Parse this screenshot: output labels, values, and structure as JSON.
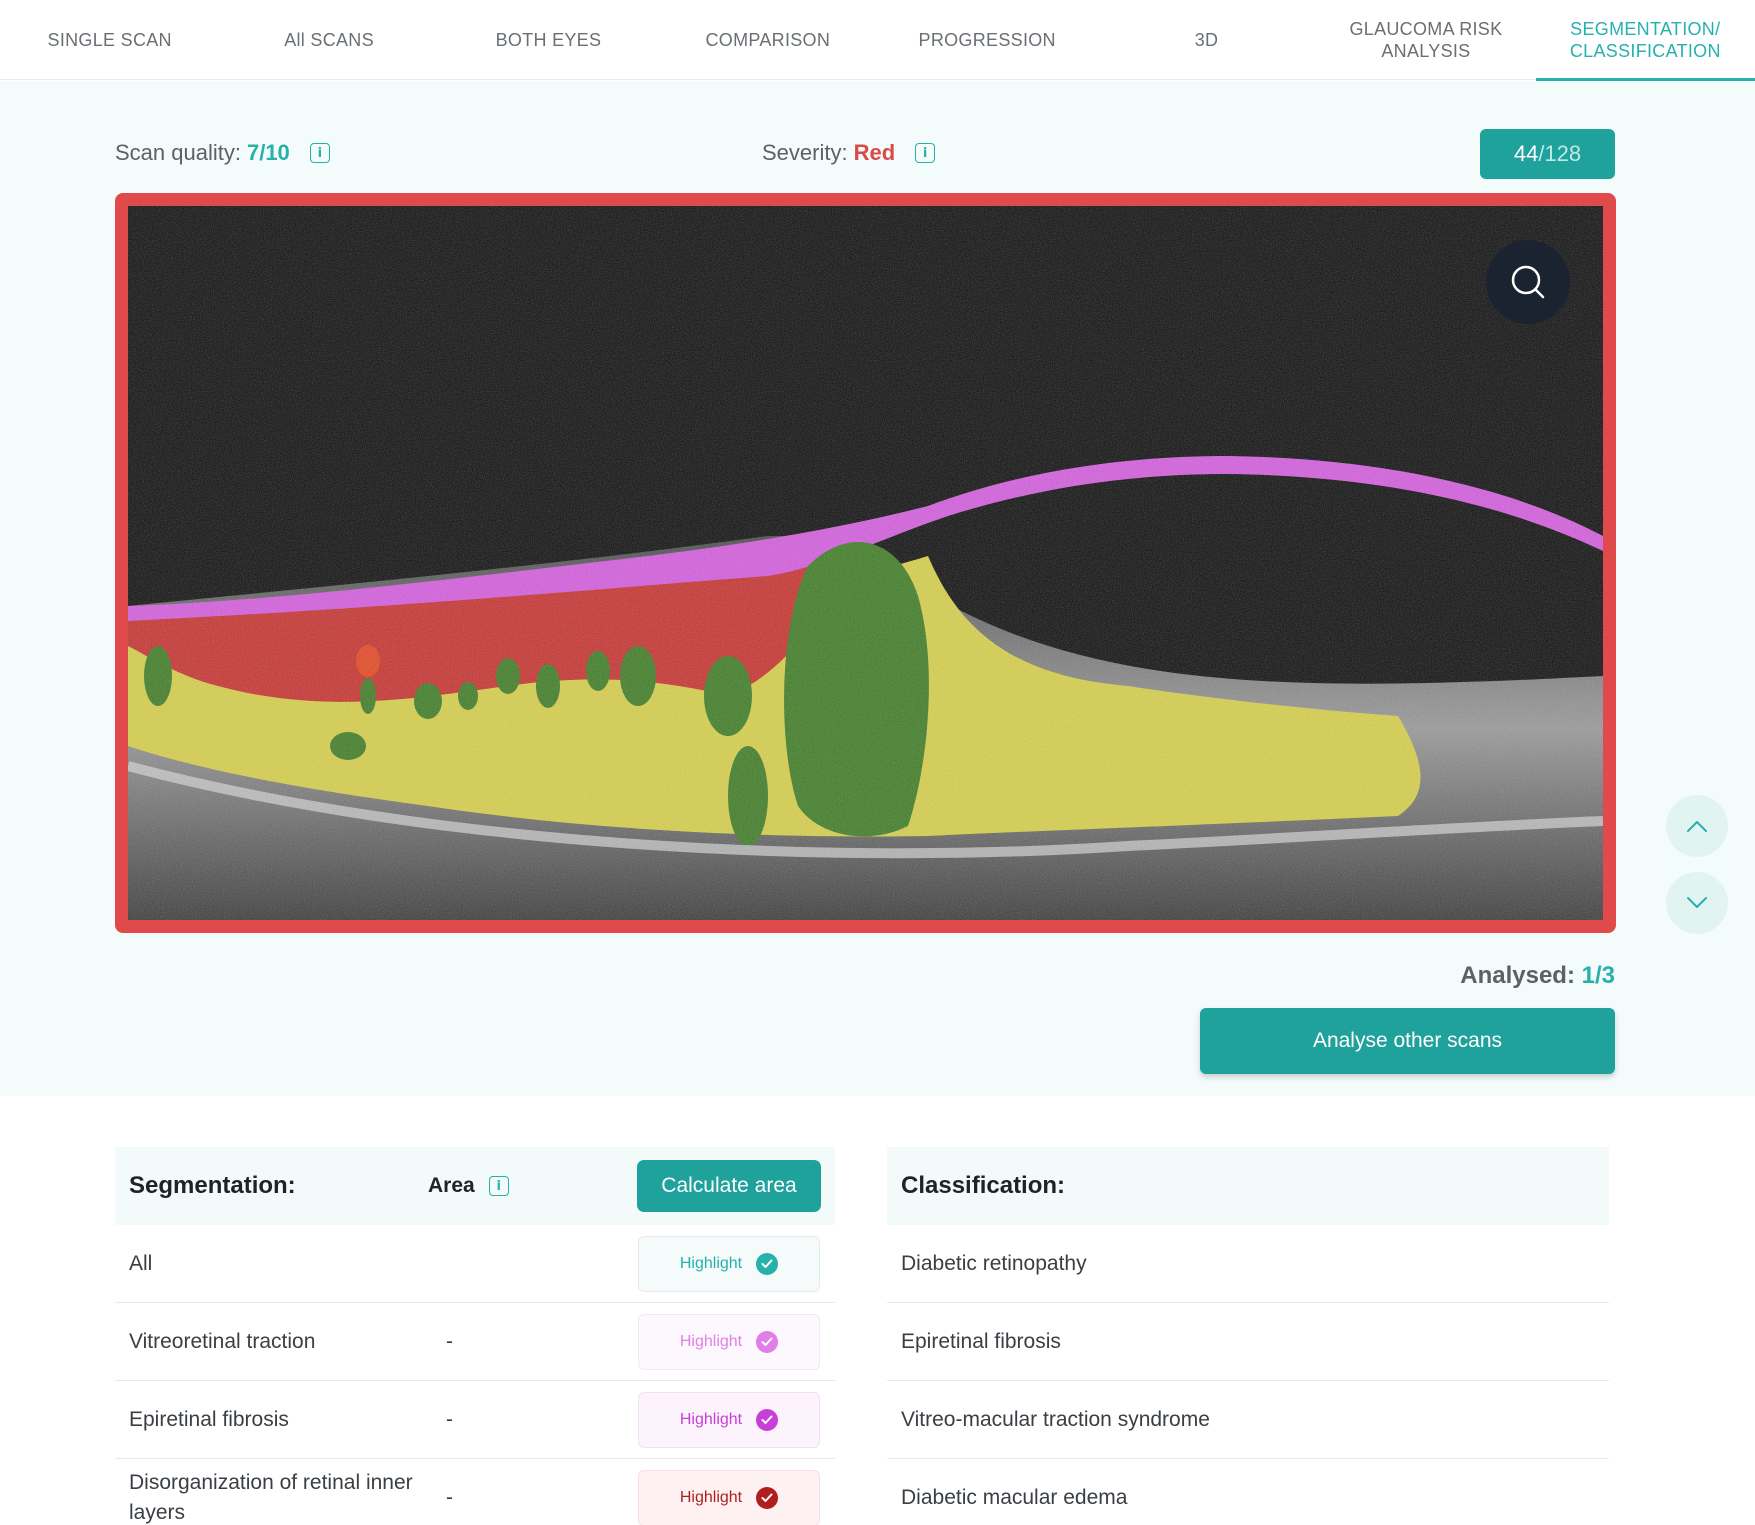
{
  "tabs": [
    {
      "label": "SINGLE SCAN",
      "active": false
    },
    {
      "label": "All SCANS",
      "active": false
    },
    {
      "label": "BOTH EYES",
      "active": false
    },
    {
      "label": "COMPARISON",
      "active": false
    },
    {
      "label": "PROGRESSION",
      "active": false
    },
    {
      "label": "3D",
      "active": false
    },
    {
      "label": "GLAUCOMA RISK\nANALYSIS",
      "active": false
    },
    {
      "label": "SEGMENTATION/\nCLASSIFICATION",
      "active": true
    }
  ],
  "scan_quality": {
    "label": "Scan quality:",
    "value": "7/10",
    "info_icon": "info-icon"
  },
  "severity": {
    "label": "Severity:",
    "value": "Red",
    "info_icon": "info-icon"
  },
  "scan_counter": {
    "current": "44",
    "total": "/128"
  },
  "scan_image": {
    "frame_color": "#e04a4a",
    "zoom_icon": "search-icon",
    "segment_colors": {
      "vitreoretinal_traction": "#d65ce0",
      "epiretinal_fibrosis": "#d65ce0",
      "disorganization": "#c8312e",
      "fluid": "#3e7d24",
      "retina": "#d8d14a"
    }
  },
  "scroll": {
    "up_icon": "chevron-up-icon",
    "down_icon": "chevron-down-icon"
  },
  "analysed": {
    "label": "Analysed:",
    "value": "1/3"
  },
  "analyse_button": "Analyse other scans",
  "segmentation": {
    "title": "Segmentation:",
    "area_label": "Area",
    "calc_button": "Calculate area",
    "rows": [
      {
        "label": "All",
        "area": "",
        "highlight": "Highlight",
        "color": "#27b1ab",
        "bg": "#f5fafa",
        "border": "#e3eded"
      },
      {
        "label": "Vitreoretinal traction",
        "area": "-",
        "highlight": "Highlight",
        "color": "#e07fe8",
        "bg": "#fdf7fe",
        "border": "#f3e6f5"
      },
      {
        "label": "Epiretinal fibrosis",
        "area": "-",
        "highlight": "Highlight",
        "color": "#c63fd6",
        "bg": "#fcf3fd",
        "border": "#f2e0f4"
      },
      {
        "label": "Disorganization of retinal inner layers",
        "area": "-",
        "highlight": "Highlight",
        "color": "#b01f1f",
        "bg": "#fdf1f1",
        "border": "#f6e0e0"
      }
    ]
  },
  "classification": {
    "title": "Classification:",
    "rows": [
      "Diabetic retinopathy",
      "Epiretinal fibrosis",
      "Vitreo-macular traction syndrome",
      "Diabetic macular edema"
    ]
  }
}
